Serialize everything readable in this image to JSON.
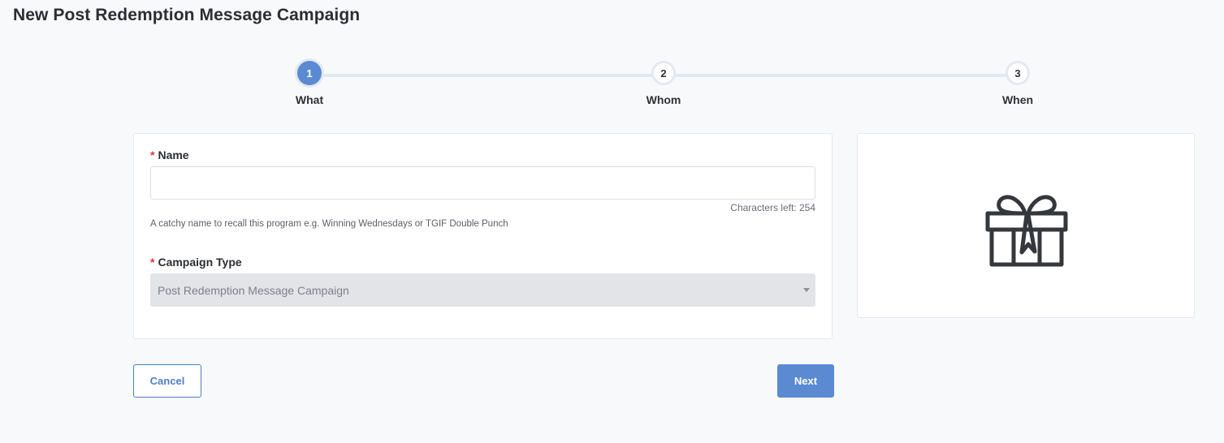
{
  "page": {
    "title": "New Post Redemption Message Campaign"
  },
  "stepper": {
    "steps": [
      {
        "number": "1",
        "label": "What",
        "active": true
      },
      {
        "number": "2",
        "label": "Whom",
        "active": false
      },
      {
        "number": "3",
        "label": "When",
        "active": false
      }
    ]
  },
  "form": {
    "name": {
      "required_marker": "*",
      "label": "Name",
      "value": "",
      "placeholder": "",
      "chars_left": "Characters left: 254",
      "help": "A catchy name to recall this program e.g. Winning Wednesdays or TGIF Double Punch"
    },
    "campaign_type": {
      "required_marker": "*",
      "label": "Campaign Type",
      "selected": "Post Redemption Message Campaign"
    }
  },
  "preview": {
    "icon": "gift-icon"
  },
  "actions": {
    "cancel_label": "Cancel",
    "next_label": "Next"
  },
  "colors": {
    "accent": "#5b8ad3",
    "required": "#e0383b",
    "background": "#f8f9fb"
  }
}
